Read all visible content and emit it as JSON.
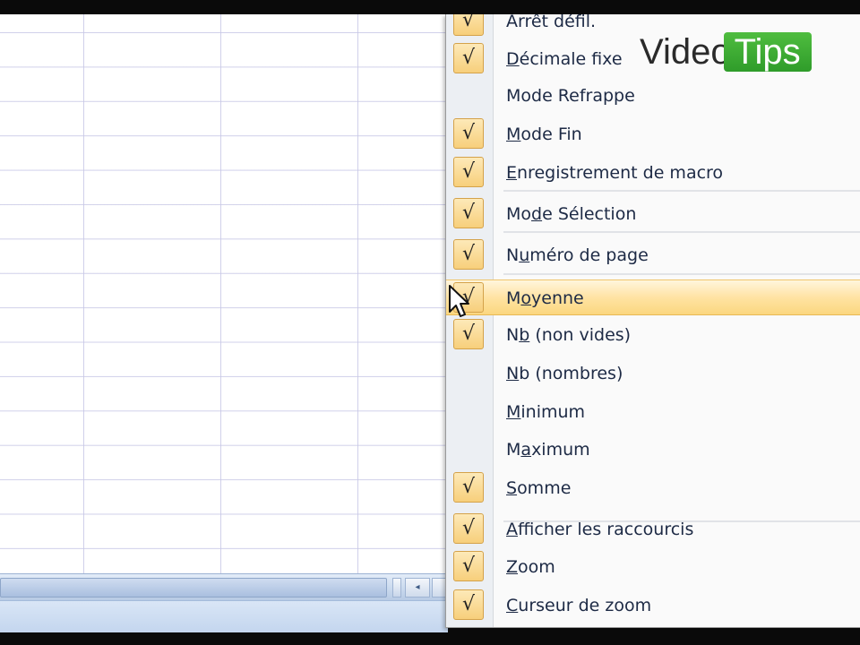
{
  "watermark": {
    "part1": "Video",
    "part2": "Tips"
  },
  "menu": {
    "items": [
      {
        "label": "Arrêt défil.",
        "accel": "",
        "checked": true
      },
      {
        "label": "Décimale fixe",
        "accel": "D",
        "checked": true
      },
      {
        "label": "Mode Refrappe",
        "accel": "",
        "checked": false
      },
      {
        "label": "Mode Fin",
        "accel": "M",
        "checked": true
      },
      {
        "label": "Enregistrement de macro",
        "accel": "E",
        "checked": true
      },
      {
        "label": "Mode Sélection",
        "accel": "d",
        "checked": true
      },
      {
        "label": "Numéro de page",
        "accel": "u",
        "checked": true
      },
      {
        "label": "Moyenne",
        "accel": "o",
        "checked": true,
        "highlighted": true
      },
      {
        "label": "Nb (non vides)",
        "accel": "b",
        "checked": true
      },
      {
        "label": "Nb (nombres)",
        "accel": "N",
        "checked": false
      },
      {
        "label": "Minimum",
        "accel": "M",
        "checked": false
      },
      {
        "label": "Maximum",
        "accel": "a",
        "checked": false
      },
      {
        "label": "Somme",
        "accel": "S",
        "checked": true
      },
      {
        "label": "Afficher les raccourcis",
        "accel": "A",
        "checked": true
      },
      {
        "label": "Zoom",
        "accel": "Z",
        "checked": true
      },
      {
        "label": "Curseur de zoom",
        "accel": "C",
        "checked": true
      }
    ],
    "check_glyph": "√"
  },
  "scrollbar": {
    "left_arrow": "◂"
  },
  "colors": {
    "highlight": "#ffe3a3",
    "check_bg": "#f7cf7b",
    "accent_green": "#3aa834"
  }
}
